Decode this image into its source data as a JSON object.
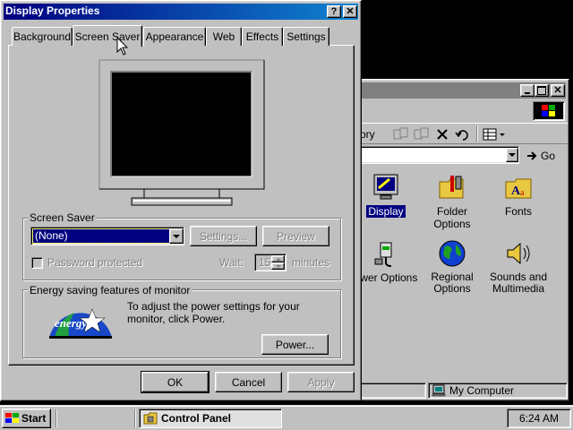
{
  "dialog": {
    "title": "Display Properties",
    "help_btn": "?",
    "close_btn": "✕",
    "tabs": [
      "Background",
      "Screen Saver",
      "Appearance",
      "Web",
      "Effects",
      "Settings"
    ],
    "active_tab": "Screen Saver",
    "screensaver_group": "Screen Saver",
    "screensaver_value": "(None)",
    "settings_btn": "Settings...",
    "preview_btn": "Preview",
    "password_label": "Password protected",
    "wait_label": "Wait:",
    "wait_value": "15",
    "minutes_label": "minutes",
    "energy_group": "Energy saving features of monitor",
    "energy_text": "To adjust the power settings for your monitor, click Power.",
    "energy_logo_text": "energy",
    "power_btn": "Power...",
    "ok_btn": "OK",
    "cancel_btn": "Cancel",
    "apply_btn": "Apply"
  },
  "explorer": {
    "address_partial": "ory",
    "go_label": "Go",
    "icons": [
      {
        "label": "Display",
        "selected": true
      },
      {
        "label": "Folder Options",
        "selected": false
      },
      {
        "label": "Fonts",
        "selected": false
      },
      {
        "label": "ower Options",
        "selected": false
      },
      {
        "label": "Regional Options",
        "selected": false
      },
      {
        "label": "Sounds and Multimedia",
        "selected": false
      }
    ],
    "status": "My Computer"
  },
  "taskbar": {
    "start_label": "Start",
    "task_label": "Control Panel",
    "clock": "6:24 AM"
  },
  "colors": {
    "face": "#c0c0c0",
    "title_active": "#000080",
    "title_inactive": "#808080",
    "selection": "#000080",
    "desktop": "#000000"
  }
}
